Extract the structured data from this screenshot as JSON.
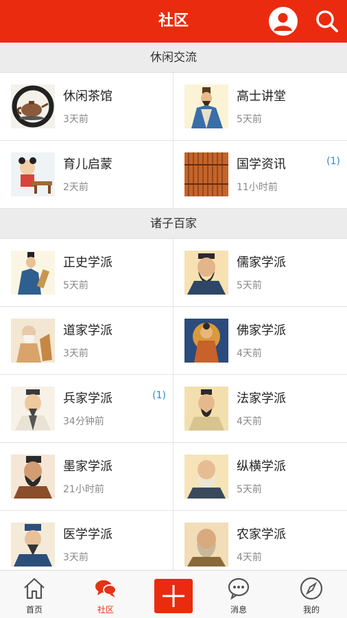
{
  "header": {
    "title": "社区"
  },
  "sections": [
    {
      "title": "休闲交流",
      "items": [
        {
          "name": "休闲茶馆",
          "time": "3天前",
          "badge": "",
          "icon": "teapot-icon"
        },
        {
          "name": "高士讲堂",
          "time": "5天前",
          "badge": "",
          "icon": "scholar-portrait-icon"
        },
        {
          "name": "育儿启蒙",
          "time": "2天前",
          "badge": "",
          "icon": "child-reading-icon"
        },
        {
          "name": "国学资讯",
          "time": "11小时前",
          "badge": "(1)",
          "icon": "bamboo-slips-icon"
        }
      ]
    },
    {
      "title": "诸子百家",
      "items": [
        {
          "name": "正史学派",
          "time": "5天前",
          "badge": "",
          "icon": "historian-portrait-icon"
        },
        {
          "name": "儒家学派",
          "time": "5天前",
          "badge": "",
          "icon": "confucius-portrait-icon"
        },
        {
          "name": "道家学派",
          "time": "3天前",
          "badge": "",
          "icon": "laozi-portrait-icon"
        },
        {
          "name": "佛家学派",
          "time": "4天前",
          "badge": "",
          "icon": "buddha-portrait-icon"
        },
        {
          "name": "兵家学派",
          "time": "34分钟前",
          "badge": "(1)",
          "icon": "strategist-portrait-icon"
        },
        {
          "name": "法家学派",
          "time": "4天前",
          "badge": "",
          "icon": "legalist-portrait-icon"
        },
        {
          "name": "墨家学派",
          "time": "21小时前",
          "badge": "",
          "icon": "mozi-portrait-icon"
        },
        {
          "name": "纵横学派",
          "time": "5天前",
          "badge": "",
          "icon": "diplomat-portrait-icon"
        },
        {
          "name": "医学学派",
          "time": "3天前",
          "badge": "",
          "icon": "physician-portrait-icon"
        },
        {
          "name": "农家学派",
          "time": "4天前",
          "badge": "",
          "icon": "farmer-sage-portrait-icon"
        }
      ]
    }
  ],
  "tabbar": {
    "home": "首页",
    "community": "社区",
    "messages": "消息",
    "mine": "我的"
  },
  "colors": {
    "accent": "#ea2b0f",
    "badge": "#2a8bc9",
    "active_tab": "#e63215"
  }
}
